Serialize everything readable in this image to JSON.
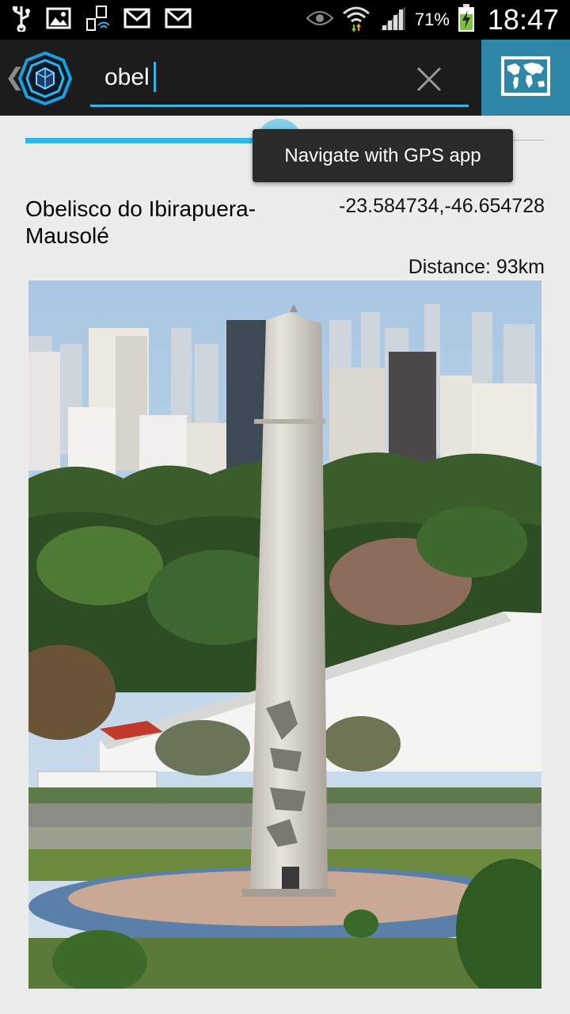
{
  "status_bar": {
    "battery_percent": "71%",
    "time": "18:47",
    "icons": [
      "usb-icon",
      "image-icon",
      "phone-wifi-icon",
      "gmail-icon",
      "gmail-icon",
      "eye-icon",
      "wifi-icon",
      "signal-icon",
      "battery-charging-icon"
    ]
  },
  "action_bar": {
    "search_value": "obel",
    "clear_icon": "close-icon",
    "map_icon": "world-map-icon"
  },
  "progress": {
    "value": 0.49
  },
  "tooltip": {
    "text": "Navigate with GPS app"
  },
  "place": {
    "name": "Obelisco do Ibirapuera-Mausolé",
    "coordinates": "-23.584734,-46.654728",
    "distance": "Distance: 93km"
  },
  "colors": {
    "accent": "#33b5e5",
    "map_button": "#2f86a6",
    "action_bar": "#1c1c1c",
    "background": "#ececec"
  }
}
